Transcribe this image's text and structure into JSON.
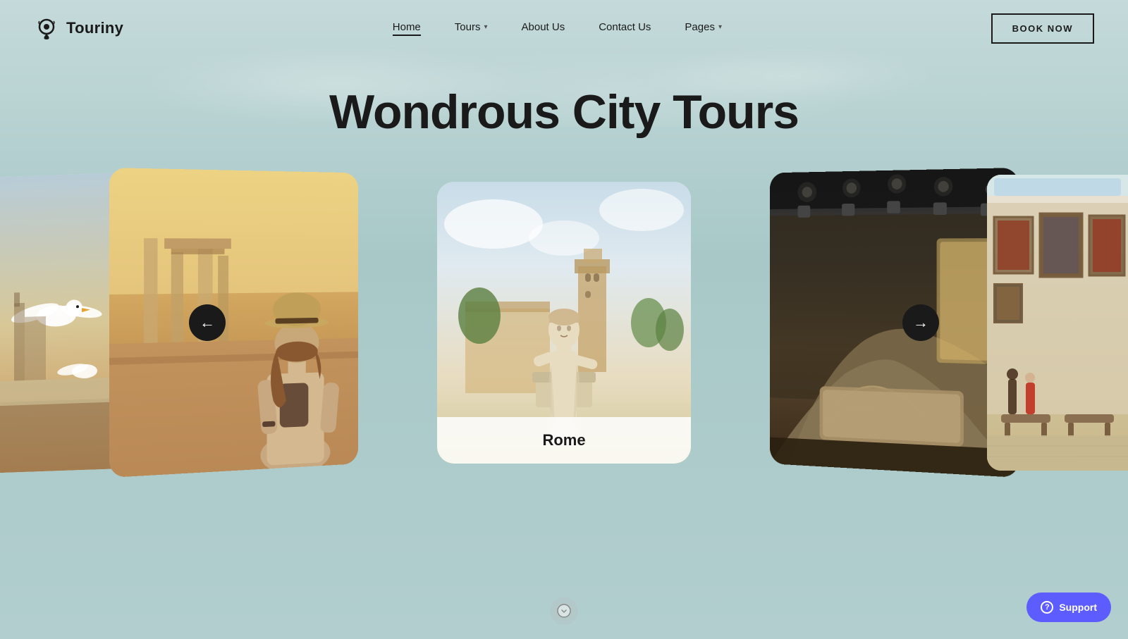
{
  "brand": {
    "name": "Touriny",
    "logo_icon": "location-pin-icon"
  },
  "nav": {
    "links": [
      {
        "label": "Home",
        "active": true,
        "has_dropdown": false
      },
      {
        "label": "Tours",
        "active": false,
        "has_dropdown": true
      },
      {
        "label": "About Us",
        "active": false,
        "has_dropdown": false
      },
      {
        "label": "Contact Us",
        "active": false,
        "has_dropdown": false
      },
      {
        "label": "Pages",
        "active": false,
        "has_dropdown": true
      }
    ],
    "cta_label": "BOOK NOW"
  },
  "hero": {
    "title": "Wondrous City Tours"
  },
  "carousel": {
    "cards": [
      {
        "id": "far-left",
        "type": "seagull",
        "label": ""
      },
      {
        "id": "left",
        "type": "ruins",
        "label": ""
      },
      {
        "id": "center",
        "type": "rome-statue",
        "label": "Rome"
      },
      {
        "id": "right",
        "type": "museum",
        "label": ""
      },
      {
        "id": "far-right",
        "type": "gallery",
        "label": ""
      }
    ],
    "prev_arrow": "←",
    "next_arrow": "→"
  },
  "support": {
    "label": "Support",
    "icon": "question-circle-icon"
  }
}
